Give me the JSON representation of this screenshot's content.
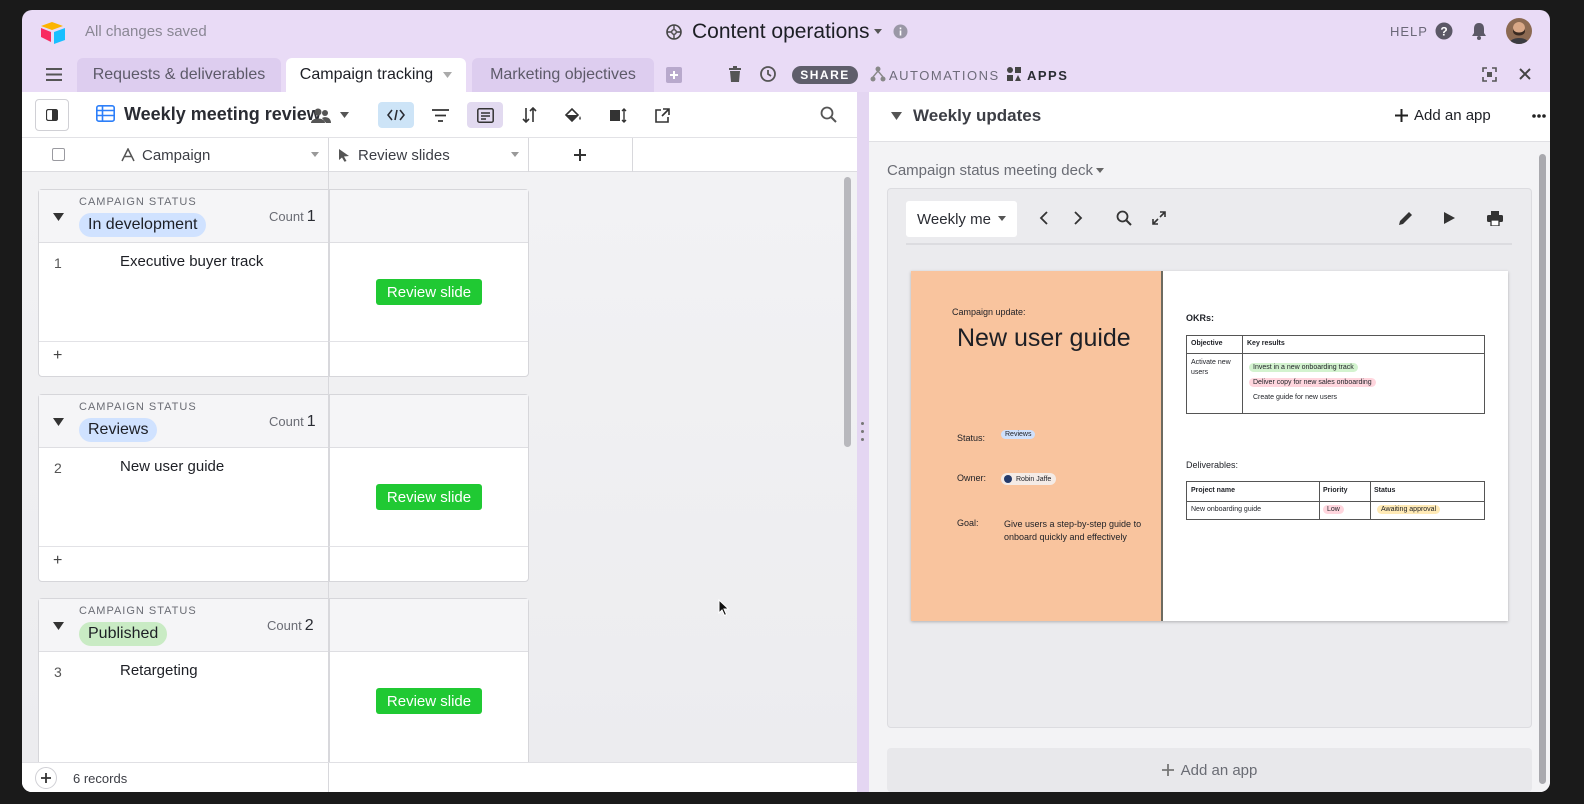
{
  "topbar": {
    "save_status": "All changes saved",
    "base_title": "Content operations",
    "help_label": "HELP"
  },
  "tabs": [
    {
      "label": "Requests & deliverables",
      "active": false
    },
    {
      "label": "Campaign tracking",
      "active": true
    },
    {
      "label": "Marketing objectives",
      "active": false
    }
  ],
  "toolbar": {
    "share_label": "SHARE",
    "automations_label": "AUTOMATIONS",
    "apps_label": "APPS"
  },
  "view": {
    "name": "Weekly meeting review"
  },
  "grid": {
    "columns": [
      "Campaign",
      "Review slides"
    ],
    "group_field_label": "CAMPAIGN STATUS",
    "count_label": "Count",
    "groups": [
      {
        "status": "In development",
        "color": "#d0e2ff",
        "count": "1",
        "rows": [
          {
            "num": "1",
            "name": "Executive buyer track",
            "button": "Review slide"
          }
        ]
      },
      {
        "status": "Reviews",
        "color": "#d0e2ff",
        "count": "1",
        "rows": [
          {
            "num": "2",
            "name": "New user guide",
            "button": "Review slide"
          }
        ]
      },
      {
        "status": "Published",
        "color": "#c9ebc4",
        "count": "2",
        "rows": [
          {
            "num": "3",
            "name": "Retargeting",
            "button": "Review slide"
          }
        ]
      }
    ],
    "records_label": "6 records",
    "add_row_symbol": "+"
  },
  "dashboard": {
    "title": "Weekly updates",
    "add_app_label": "Add an app",
    "block_title": "Campaign status meeting deck",
    "slide_select_value": "Weekly me",
    "add_app_bottom_label": "Add an app"
  },
  "slide": {
    "kicker": "Campaign update:",
    "title": "New user guide",
    "status_label": "Status:",
    "status_value": "Reviews",
    "owner_label": "Owner:",
    "owner_value": "Robin Jaffe",
    "goal_label": "Goal:",
    "goal_value": "Give users a step-by-step guide to onboard quickly and effectively",
    "okrs_label": "OKRs:",
    "okr_headers": [
      "Objective",
      "Key results"
    ],
    "okr_objective": "Activate new users",
    "key_results": [
      {
        "text": "Invest in a new onboarding track",
        "color": "#d3f3cf"
      },
      {
        "text": "Deliver copy for new sales onboarding",
        "color": "#ffd6de"
      },
      {
        "text": "Create guide for new users",
        "color": "#ffffff"
      }
    ],
    "deliverables_label": "Deliverables:",
    "deliv_headers": [
      "Project name",
      "Priority",
      "Status"
    ],
    "deliv_row": {
      "name": "New onboarding guide",
      "priority": "Low",
      "status": "Awaiting approval"
    }
  },
  "colors": {
    "accent_purple": "#e9dbf6",
    "button_green": "#20c933",
    "slide_orange": "#f9c49e"
  }
}
